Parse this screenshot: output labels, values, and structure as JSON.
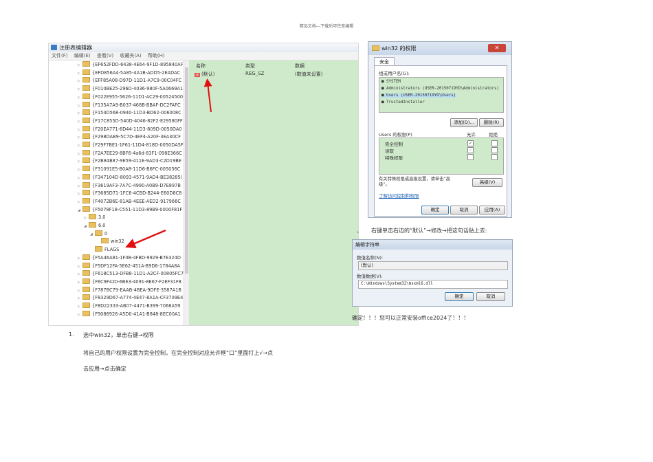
{
  "header": {
    "text": "精品文档---下载后可任意编辑"
  },
  "registry": {
    "title": "注册表编辑器",
    "menu": [
      "文件(F)",
      "编辑(E)",
      "查看(V)",
      "收藏夹(A)",
      "帮助(H)"
    ],
    "tree": [
      {
        "label": "{EF652FDD-6438-4E64-9F1D-895840AF",
        "level": 0,
        "exp": "closed"
      },
      {
        "label": "{EFD856A4-5A85-4A1B-ADD5-2EADAC",
        "level": 0,
        "exp": "closed"
      },
      {
        "label": "{EFF85A08-D97D-11D1-A7C9-00C04FC",
        "level": 0,
        "exp": "closed"
      },
      {
        "label": "{F010BE25-296D-4036-980F-5A0669A1",
        "level": 0,
        "exp": "closed"
      },
      {
        "label": "{F022E955-5626-11D1-AC29-00524500",
        "level": 0,
        "exp": "closed"
      },
      {
        "label": "{F135A7A9-B037-468B-BBAF-DC2FAFC",
        "level": 0,
        "exp": "closed"
      },
      {
        "label": "{F154D568-0940-11D3-BD62-006008C",
        "level": 0,
        "exp": "closed"
      },
      {
        "label": "{F17C855D-540D-4046-82F2-E29580FF",
        "level": 0,
        "exp": "closed"
      },
      {
        "label": "{F20EA771-6D44-11D3-809D-0050DA0",
        "level": 0,
        "exp": "closed"
      },
      {
        "label": "{F298DAB9-5C7D-4EF4-A20F-3EA30CF",
        "level": 0,
        "exp": "closed"
      },
      {
        "label": "{F29F7BE1-1F61-11D4-818D-0050DA5F",
        "level": 0,
        "exp": "closed"
      },
      {
        "label": "{F2A7EE29-8BF6-4a6d-83F1-098E366C",
        "level": 0,
        "exp": "closed"
      },
      {
        "label": "{F2B84B87-9E59-411E-9AD3-C2D19BE",
        "level": 0,
        "exp": "closed"
      },
      {
        "label": "{F31091E5-B0A8-11D6-B6FC-005056C",
        "level": 0,
        "exp": "closed"
      },
      {
        "label": "{F347104D-8093-4571-9AD4-BE38285/",
        "level": 0,
        "exp": "closed"
      },
      {
        "label": "{F3619AF3-7A7C-4990-A0B9-D7E897B",
        "level": 0,
        "exp": "closed"
      },
      {
        "label": "{F3685D71-1FC6-4CBD-B244-E60D8C8",
        "level": 0,
        "exp": "closed"
      },
      {
        "label": "{F4072B6E-81AB-4EEE-AED2-917966C",
        "level": 0,
        "exp": "closed"
      },
      {
        "label": "{F5078F18-C551-11D3-89B9-0000F81F",
        "level": 0,
        "exp": "open"
      },
      {
        "label": "3.0",
        "level": 1,
        "exp": "closed"
      },
      {
        "label": "6.0",
        "level": 1,
        "exp": "open"
      },
      {
        "label": "0",
        "level": 2,
        "exp": "open"
      },
      {
        "label": "win32",
        "level": 3,
        "exp": "none"
      },
      {
        "label": "FLAGS",
        "level": 2,
        "exp": "none"
      },
      {
        "label": "{F5A46A81-1F0B-4FBD-9929-B7E324D",
        "level": 0,
        "exp": "closed"
      },
      {
        "label": "{F5DF12FA-5E62-451A-B9D6-1784A8A",
        "level": 0,
        "exp": "closed"
      },
      {
        "label": "{F618C513-DFB8-11D1-A2CF-00805FC7",
        "level": 0,
        "exp": "closed"
      },
      {
        "label": "{F6C9F420-6BE3-4091-8E67-F2EF31F8",
        "level": 0,
        "exp": "closed"
      },
      {
        "label": "{F787BC79-EAAB-4BEA-9DFE-3587A1B",
        "level": 0,
        "exp": "closed"
      },
      {
        "label": "{F8329D67-A774-4E47-8A1A-CF3709E4",
        "level": 0,
        "exp": "closed"
      },
      {
        "label": "{F8D22333-AB07-4471-B399-7068A59",
        "level": 0,
        "exp": "closed"
      },
      {
        "label": "{F9086926-A5D0-41A1-B848-8EC00A1",
        "level": 0,
        "exp": "closed"
      }
    ],
    "columns": {
      "name": "名称",
      "type": "类型",
      "data": "数据"
    },
    "value_row": {
      "name": "(默认)",
      "type": "REG_SZ",
      "data": "(数值未设置)"
    }
  },
  "permissions": {
    "title": "win32 的权限",
    "tab": "安全",
    "group_label": "组或用户名(G):",
    "users": [
      "SYSTEM",
      "Administrators (USER-20150719YD\\Administrators)",
      "Users (USER-20150719YD\\Users)",
      "TrustedInstaller"
    ],
    "add": "添加(D)...",
    "remove": "删除(R)",
    "perm_label": "Users 的权限(P)",
    "allow": "允许",
    "deny": "拒绝",
    "rows": [
      {
        "label": "完全控制",
        "allow": "✓",
        "deny": ""
      },
      {
        "label": "读取",
        "allow": "✓",
        "deny": ""
      },
      {
        "label": "特殊权限",
        "allow": "",
        "deny": ""
      }
    ],
    "advanced_note": "有关特殊权限或高级设置，请单击“高级”。",
    "advanced_btn": "高级(V)",
    "link": "了解访问控制和权限",
    "ok": "确定",
    "cancel": "取消",
    "apply": "应用(A)"
  },
  "side_step": {
    "marker": "、",
    "text": "右键单击右边的“默认”→修改→把这句话贴上去:"
  },
  "edit_string": {
    "title": "编辑字符串",
    "name_label": "数值名称(N):",
    "name_value": "(默认)",
    "data_label": "数值数据(V):",
    "data_value": "C:\\Windows\\System32\\msxml6.dll",
    "ok": "确定",
    "cancel": "取消"
  },
  "final_note": "确定！！！您可以正常安装office2024了！！！",
  "steps": {
    "num": "1.",
    "s1": "选中win32，单击右键→权限",
    "s2": "将自己的用户权限设置为完全控制，在完全控制对应允许框“口”里面打上√→点",
    "s3": "击应用→点击确定"
  }
}
